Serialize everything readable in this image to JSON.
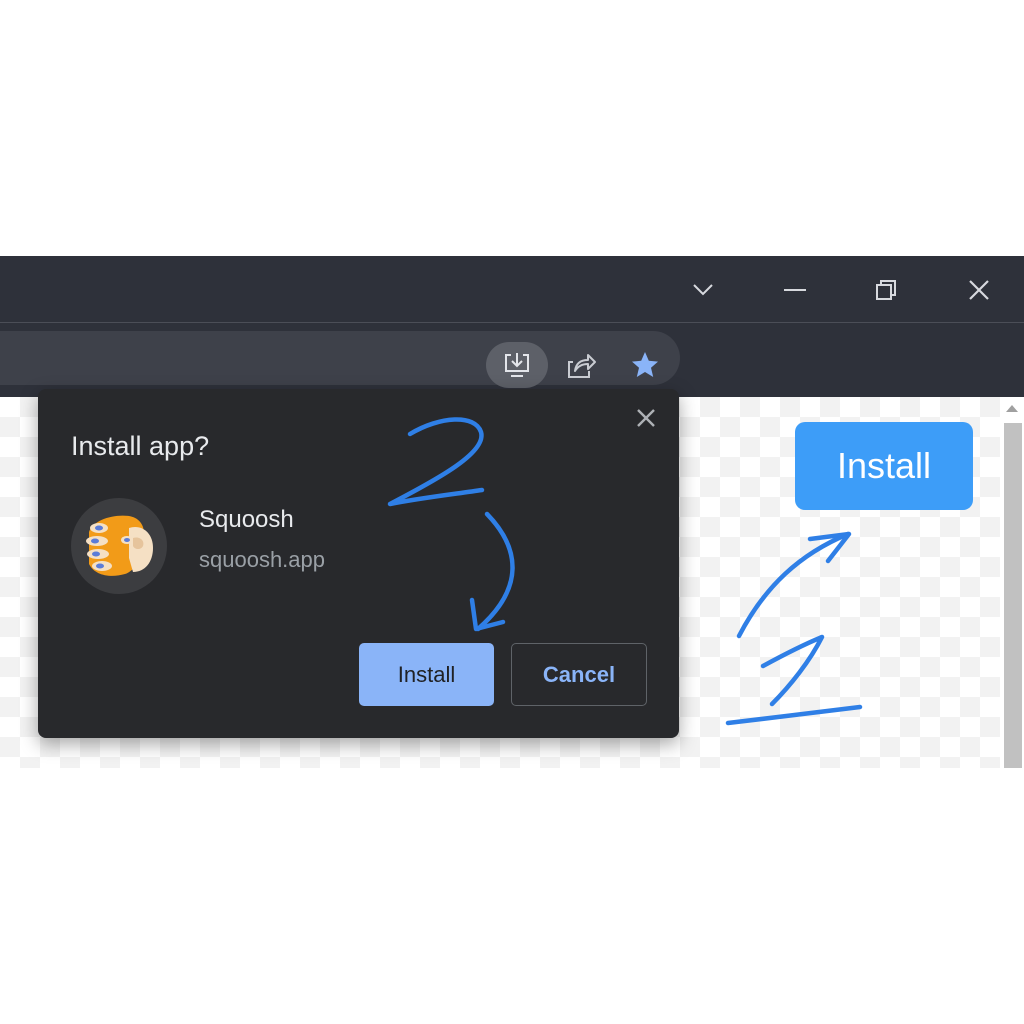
{
  "browser": {
    "window_controls": {
      "tab_search": "chevron-down-icon",
      "minimize": "minimize-icon",
      "restore": "restore-icon",
      "close": "close-icon"
    },
    "toolbar": {
      "install_app": "install-app-icon",
      "share": "share-icon",
      "bookmark": "star-icon"
    }
  },
  "dialog": {
    "title": "Install app?",
    "app_name": "Squoosh",
    "app_url": "squoosh.app",
    "install_label": "Install",
    "cancel_label": "Cancel"
  },
  "page": {
    "install_button_label": "Install"
  },
  "annotations": {
    "step_one": "1",
    "step_two": "2"
  },
  "colors": {
    "chrome_bg": "#2e313a",
    "dialog_bg": "#28292c",
    "accent": "#8ab4f8",
    "page_button": "#3d9df8",
    "annotation_ink": "#2f7fe6"
  }
}
